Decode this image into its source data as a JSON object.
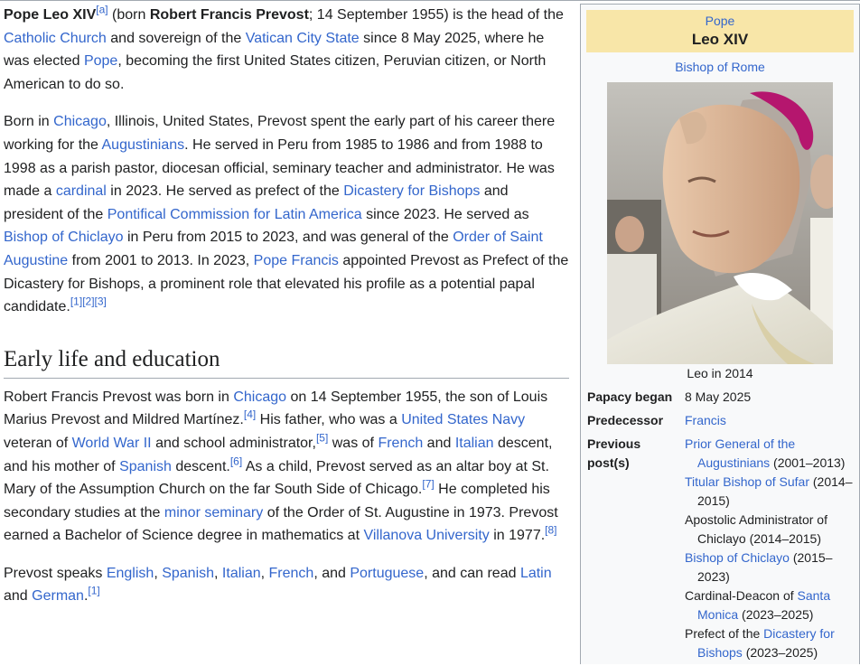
{
  "article": {
    "intro": {
      "name_bold": "Pope Leo XIV",
      "note_a": "[a]",
      "t1": " (born ",
      "birth_name": "Robert Francis Prevost",
      "t2": "; 14 September 1955) is the head of the ",
      "link_church": "Catholic Church",
      "t3": " and sovereign of the ",
      "link_vatican": "Vatican City State",
      "t4": " since 8 May 2025, where he was elected ",
      "link_pope": "Pope",
      "t5": ", becoming the first United States citizen, Peruvian citizen, or North American to do so."
    },
    "para2": {
      "t1": "Born in ",
      "link_chicago": "Chicago",
      "t2": ", Illinois, United States, Prevost spent the early part of his career there working for the ",
      "link_augustinians": "Augustinians",
      "t3": ". He served in Peru from 1985 to 1986 and from 1988 to 1998 as a parish pastor, diocesan official, seminary teacher and administrator. He was made a ",
      "link_cardinal": "cardinal",
      "t4": " in 2023. He served as prefect of the ",
      "link_dicastery": "Dicastery for Bishops",
      "t5": " and president of the ",
      "link_commission": "Pontifical Commission for Latin America",
      "t6": " since 2023. He served as ",
      "link_chiclayo": "Bishop of Chiclayo",
      "t7": " in Peru from 2015 to 2023, and was general of the ",
      "link_order": "Order of Saint Augustine",
      "t8": " from 2001 to 2013. In 2023, ",
      "link_francis": "Pope Francis",
      "t9": " appointed Prevost as Prefect of the Dicastery for Bishops, a prominent role that elevated his profile as a potential papal candidate.",
      "ref1": "[1]",
      "ref2": "[2]",
      "ref3": "[3]"
    },
    "section_heading": "Early life and education",
    "para3": {
      "t1": "Robert Francis Prevost was born in ",
      "link_chicago": "Chicago",
      "t2": " on 14 September 1955, the son of Louis Marius Prevost and Mildred Martínez.",
      "ref4": "[4]",
      "t3": " His father, who was a ",
      "link_navy": "United States Navy",
      "t4": " veteran of ",
      "link_ww2": "World War II",
      "t5": " and school administrator,",
      "ref5": "[5]",
      "t6": " was of ",
      "link_french": "French",
      "t7": " and ",
      "link_italian": "Italian",
      "t8": " descent, and his mother of ",
      "link_spanish": "Spanish",
      "t9": " descent.",
      "ref6": "[6]",
      "t10": " As a child, Prevost served as an altar boy at St. Mary of the Assumption Church on the far South Side of Chicago.",
      "ref7": "[7]",
      "t11": " He completed his secondary studies at the ",
      "link_seminary": "minor seminary",
      "t12": " of the Order of St. Augustine in 1973. Prevost earned a Bachelor of Science degree in mathematics at ",
      "link_villanova": "Villanova University",
      "t13": " in 1977.",
      "ref8": "[8]"
    },
    "para4": {
      "t1": "Prevost speaks ",
      "link_english": "English",
      "c1": ", ",
      "link_spanish": "Spanish",
      "c2": ", ",
      "link_italian": "Italian",
      "c3": ", ",
      "link_french": "French",
      "c4": ", and ",
      "link_portuguese": "Portuguese",
      "t2": ", and can read ",
      "link_latin": "Latin",
      "t3": " and ",
      "link_german": "German",
      "t4": ".",
      "ref1": "[1]"
    }
  },
  "infobox": {
    "super_title": "Pope",
    "title": "Leo XIV",
    "subtitle": "Bishop of Rome",
    "caption": "Leo in 2014",
    "papacy_label": "Papacy began",
    "papacy_value": "8 May 2025",
    "predecessor_label": "Predecessor",
    "predecessor_value": "Francis",
    "previous_label": "Previous post(s)",
    "posts": [
      {
        "link": "Prior General of the Augustinians",
        "years": " (2001–2013)"
      },
      {
        "link": "Titular Bishop of Sufar",
        "years": " (2014–2015)"
      },
      {
        "plain": "Apostolic Administrator of Chiclayo",
        "years": " (2014–2015)"
      },
      {
        "link": "Bishop of Chiclayo",
        "years": " (2015–2023)"
      },
      {
        "plain": "Cardinal-Deacon of ",
        "link": "Santa Monica",
        "years": " (2023–2025)"
      },
      {
        "plain": "Prefect of the ",
        "link": "Dicastery for Bishops",
        "years": " (2023–2025)"
      }
    ]
  },
  "colors": {
    "link": "#3366cc",
    "infobox_header": "#f8e6a8",
    "infobox_bg": "#f8f9fa",
    "border": "#a2a9b1"
  },
  "icons": {
    "portrait": "portrait-photo"
  }
}
